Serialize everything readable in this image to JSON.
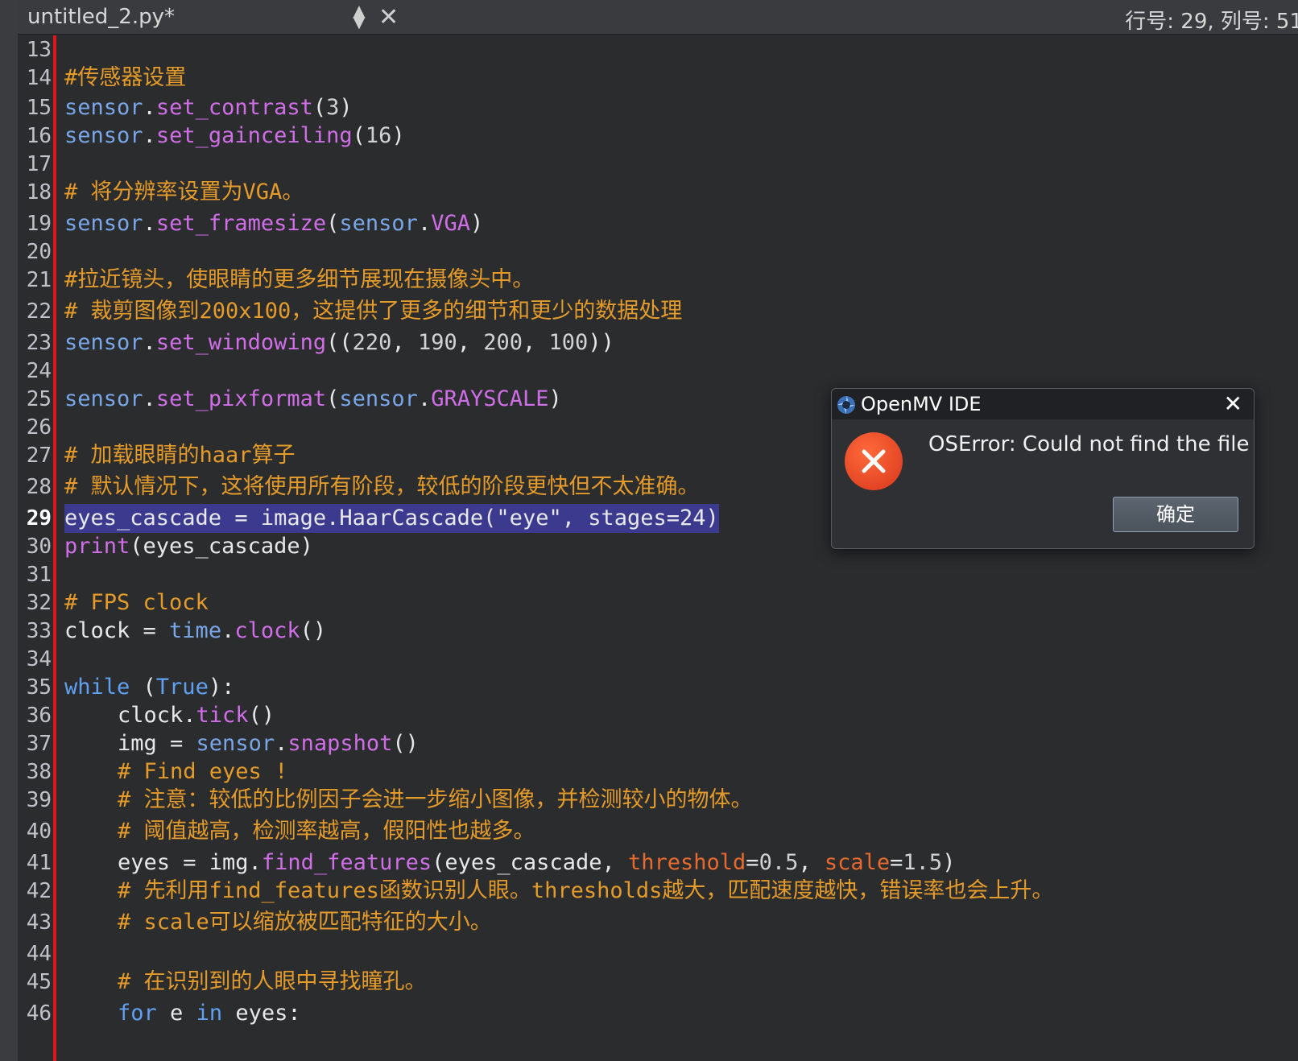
{
  "tab": {
    "filename": "untitled_2.py*",
    "position": "行号: 29, 列号: 51"
  },
  "dialog": {
    "title": "OpenMV IDE",
    "message": "OSError: Could not find the file",
    "ok_label": "确定",
    "icon": "error-icon"
  },
  "editor": {
    "current_line": "29",
    "lines": [
      {
        "n": "13"
      },
      {
        "n": "14",
        "t": "#传感器设置"
      },
      {
        "n": "15",
        "t": "sensor.set_contrast(3)"
      },
      {
        "n": "16",
        "t": "sensor.set_gainceiling(16)"
      },
      {
        "n": "17"
      },
      {
        "n": "18",
        "t": "# 将分辨率设置为VGA。"
      },
      {
        "n": "19",
        "t": "sensor.set_framesize(sensor.VGA)"
      },
      {
        "n": "20"
      },
      {
        "n": "21",
        "t": "#拉近镜头，使眼睛的更多细节展现在摄像头中。"
      },
      {
        "n": "22",
        "t": "# 裁剪图像到200x100，这提供了更多的细节和更少的数据处理"
      },
      {
        "n": "23",
        "t": "sensor.set_windowing((220, 190, 200, 100))"
      },
      {
        "n": "24"
      },
      {
        "n": "25",
        "t": "sensor.set_pixformat(sensor.GRAYSCALE)"
      },
      {
        "n": "26"
      },
      {
        "n": "27",
        "t": "# 加载眼睛的haar算子"
      },
      {
        "n": "28",
        "t": "# 默认情况下，这将使用所有阶段，较低的阶段更快但不太准确。"
      },
      {
        "n": "29",
        "t": "eyes_cascade = image.HaarCascade(\"eye\", stages=24)"
      },
      {
        "n": "30",
        "t": "print(eyes_cascade)"
      },
      {
        "n": "31"
      },
      {
        "n": "32",
        "t": "# FPS clock"
      },
      {
        "n": "33",
        "t": "clock = time.clock()"
      },
      {
        "n": "34"
      },
      {
        "n": "35",
        "t": "while (True):"
      },
      {
        "n": "36",
        "t": "clock.tick()"
      },
      {
        "n": "37",
        "t": "img = sensor.snapshot()"
      },
      {
        "n": "38",
        "t": "# Find eyes !"
      },
      {
        "n": "39",
        "t": "# 注意：较低的比例因子会进一步缩小图像，并检测较小的物体。"
      },
      {
        "n": "40",
        "t": "# 阈值越高，检测率越高，假阳性也越多。"
      },
      {
        "n": "41",
        "t": "eyes = img.find_features(eyes_cascade, threshold=0.5, scale=1.5)"
      },
      {
        "n": "42",
        "t": "# 先利用find_features函数识别人眼。thresholds越大，匹配速度越快，错误率也会上升。"
      },
      {
        "n": "43",
        "t": "# scale可以缩放被匹配特征的大小。"
      },
      {
        "n": "44"
      },
      {
        "n": "45",
        "t": "# 在识别到的人眼中寻找瞳孔。"
      },
      {
        "n": "46",
        "t": "for e in eyes:"
      }
    ]
  }
}
